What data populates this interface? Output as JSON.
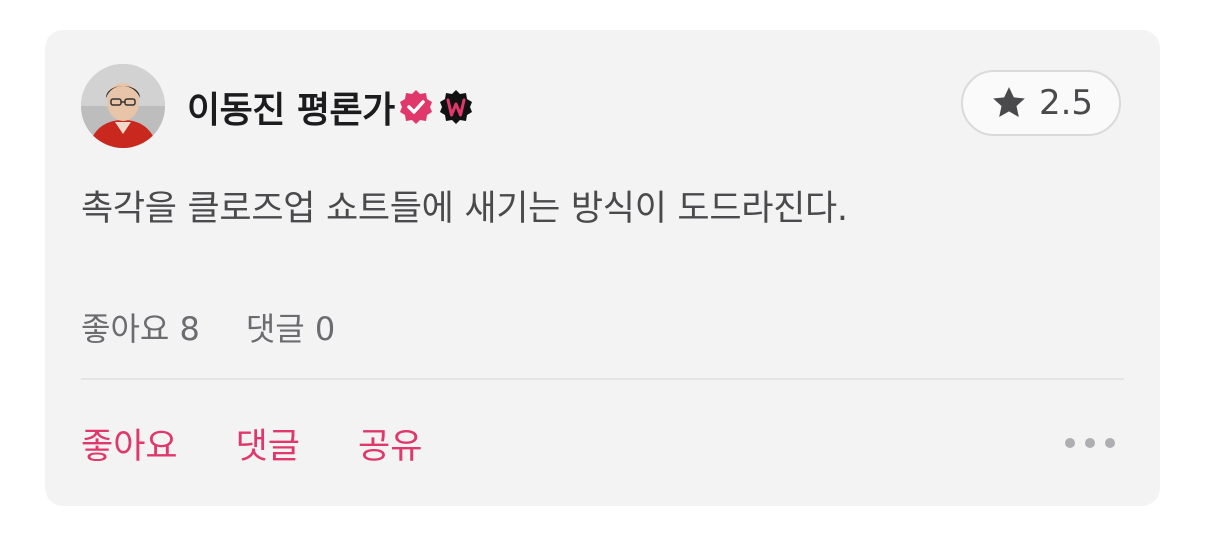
{
  "review": {
    "author_name": "이동진 평론가",
    "verified_badge_icon": "verified-check-icon",
    "watcha_badge_icon": "w-badge-icon",
    "rating": "2.5",
    "rating_icon": "star-icon",
    "text": "촉각을 클로즈업 쇼트들에 새기는 방식이 도드라진다.",
    "stats": {
      "likes": "좋아요 8",
      "comments": "댓글 0"
    },
    "actions": {
      "like": "좋아요",
      "comment": "댓글",
      "share": "공유"
    },
    "more_icon": "more-horizontal-icon"
  },
  "colors": {
    "accent": "#e0386a",
    "card_background": "#f3f3f4",
    "text_primary": "#1c1c1e",
    "text_secondary": "#6c6c70"
  }
}
